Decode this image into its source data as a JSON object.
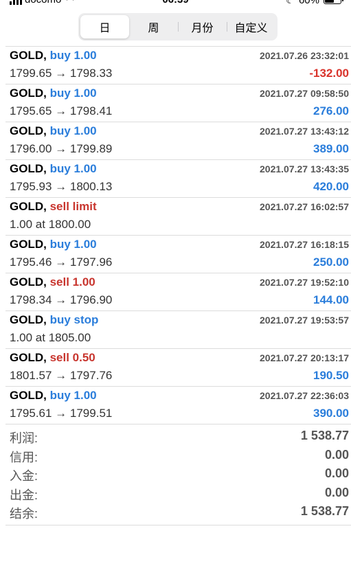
{
  "status_bar": {
    "carrier": "docomo",
    "time": "06:39",
    "battery": "60%"
  },
  "tabs": [
    {
      "label": "日",
      "active": true
    },
    {
      "label": "周",
      "active": false
    },
    {
      "label": "月份",
      "active": false
    },
    {
      "label": "自定义",
      "active": false
    }
  ],
  "orders": [
    {
      "symbol": "GOLD,",
      "action": "buy 1.00",
      "action_color": "#2a7ddb",
      "date": "2021.07.26 23:32:01",
      "prices": "1799.65 → 1798.33",
      "profit": "-132.00",
      "profit_color": "#d9332b"
    },
    {
      "symbol": "GOLD,",
      "action": "buy 1.00",
      "action_color": "#2a7ddb",
      "date": "2021.07.27 09:58:50",
      "prices": "1795.65 → 1798.41",
      "profit": "276.00",
      "profit_color": "#2a7ddb"
    },
    {
      "symbol": "GOLD,",
      "action": "buy 1.00",
      "action_color": "#2a7ddb",
      "date": "2021.07.27 13:43:12",
      "prices": "1796.00 → 1799.89",
      "profit": "389.00",
      "profit_color": "#2a7ddb"
    },
    {
      "symbol": "GOLD,",
      "action": "buy 1.00",
      "action_color": "#2a7ddb",
      "date": "2021.07.27 13:43:35",
      "prices": "1795.93 → 1800.13",
      "profit": "420.00",
      "profit_color": "#2a7ddb"
    },
    {
      "symbol": "GOLD,",
      "action": "sell limit",
      "action_color": "#c8352e",
      "date": "2021.07.27 16:02:57",
      "prices": "1.00 at 1800.00",
      "profit": "",
      "profit_color": "#2a7ddb"
    },
    {
      "symbol": "GOLD,",
      "action": "buy 1.00",
      "action_color": "#2a7ddb",
      "date": "2021.07.27 16:18:15",
      "prices": "1795.46 → 1797.96",
      "profit": "250.00",
      "profit_color": "#2a7ddb"
    },
    {
      "symbol": "GOLD,",
      "action": "sell 1.00",
      "action_color": "#c8352e",
      "date": "2021.07.27 19:52:10",
      "prices": "1798.34 → 1796.90",
      "profit": "144.00",
      "profit_color": "#2a7ddb"
    },
    {
      "symbol": "GOLD,",
      "action": "buy stop",
      "action_color": "#2a7ddb",
      "date": "2021.07.27 19:53:57",
      "prices": "1.00 at 1805.00",
      "profit": "",
      "profit_color": "#2a7ddb"
    },
    {
      "symbol": "GOLD,",
      "action": "sell 0.50",
      "action_color": "#c8352e",
      "date": "2021.07.27 20:13:17",
      "prices": "1801.57 → 1797.76",
      "profit": "190.50",
      "profit_color": "#2a7ddb"
    },
    {
      "symbol": "GOLD,",
      "action": "buy 1.00",
      "action_color": "#2a7ddb",
      "date": "2021.07.27 22:36:03",
      "prices": "1795.61 → 1799.51",
      "profit": "390.00",
      "profit_color": "#2a7ddb"
    }
  ],
  "summary": [
    {
      "label": "利润:",
      "value": "1 538.77"
    },
    {
      "label": "信用:",
      "value": "0.00"
    },
    {
      "label": "入金:",
      "value": "0.00"
    },
    {
      "label": "出金:",
      "value": "0.00"
    },
    {
      "label": "结余:",
      "value": "1 538.77"
    }
  ]
}
